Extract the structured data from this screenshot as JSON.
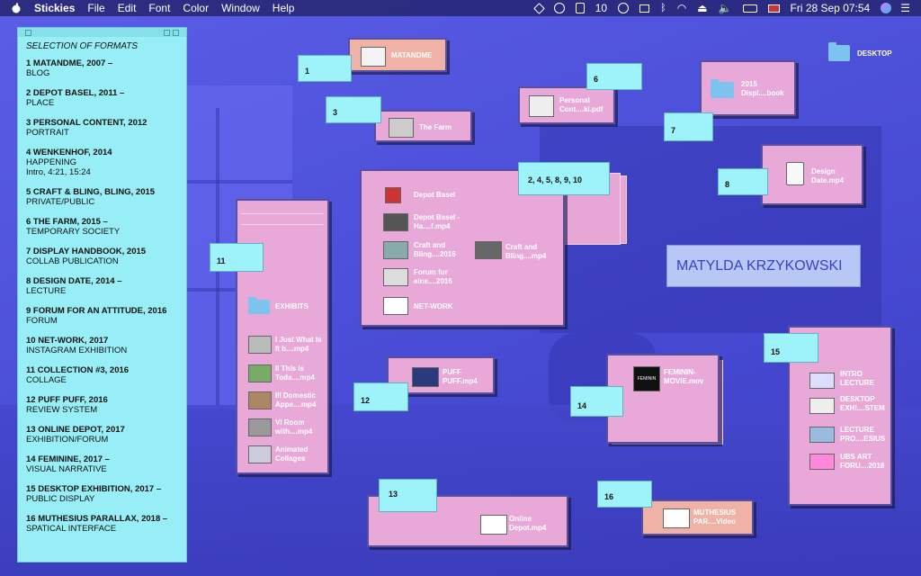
{
  "menubar": {
    "app": "Stickies",
    "menus": [
      "File",
      "Edit",
      "Font",
      "Color",
      "Window",
      "Help"
    ],
    "battery_status": "10",
    "clock": "Fri 28 Sep  07:54"
  },
  "stickies_list": {
    "header": "SELECTION OF FORMATS",
    "items": [
      {
        "title": "1 MATANDME, 2007 –",
        "sub": "BLOG"
      },
      {
        "title": "2 DEPOT BASEL, 2011 –",
        "sub": "PLACE"
      },
      {
        "title": "3 PERSONAL CONTENT, 2012",
        "sub": "PORTRAIT"
      },
      {
        "title": "4 WENKENHOF, 2014",
        "sub": "HAPPENING",
        "extra": "Intro, 4:21, 15:24"
      },
      {
        "title": "5 CRAFT & BLING, BLING, 2015",
        "sub": "PRIVATE/PUBLIC"
      },
      {
        "title": "6 THE FARM, 2015 –",
        "sub": "TEMPORARY SOCIETY"
      },
      {
        "title": "7 DISPLAY HANDBOOK, 2015",
        "sub": "COLLAB PUBLICATION"
      },
      {
        "title": "8 DESIGN DATE, 2014 –",
        "sub": "LECTURE"
      },
      {
        "title": "9 FORUM FOR AN ATTITUDE, 2016",
        "sub": "FORUM"
      },
      {
        "title": "10 NET-WORK, 2017",
        "sub": "INSTAGRAM EXHIBITION"
      },
      {
        "title": "11 COLLECTION #3, 2016",
        "sub": "COLLAGE"
      },
      {
        "title": "12 PUFF PUFF, 2016",
        "sub": "REVIEW SYSTEM"
      },
      {
        "title": "13 ONLINE DEPOT, 2017",
        "sub": "EXHIBITION/FORUM"
      },
      {
        "title": "14 FEMININE, 2017 –",
        "sub": "VISUAL NARRATIVE"
      },
      {
        "title": "15 DESKTOP EXHIBITION, 2017 –",
        "sub": "PUBLIC DISPLAY"
      },
      {
        "title": "16 MUTHESIUS PARALLAX, 2018 –",
        "sub": "SPATICAL INTERFACE"
      }
    ]
  },
  "desktop": {
    "desktop_folder": "DESKTOP",
    "name_sticky": "MATYLDA KRZYKOWSKI",
    "notes": {
      "n1": "1",
      "n2": "2, 4, 5, 8, 9, 10",
      "n3": "3",
      "n6": "6",
      "n7": "7",
      "n8": "8",
      "n11": "11",
      "n12": "12",
      "n13": "13",
      "n14": "14",
      "n15": "15",
      "n16": "16"
    },
    "labels": {
      "matandme": "MATANDME",
      "personal": "Personal Cont....ki.pdf",
      "farm": "The Farm",
      "display": "2015 Displ....book",
      "design_date": "Design Date.mp4",
      "depot_basel": "Depot Basel",
      "depot_basel_mp4": "Depot Basel - Ha....f.mp4",
      "craft1": "Craft and Bling....2016",
      "craft2": "Craft and Bling....mp4",
      "forum": "Forum fur eine....2016",
      "network": "NET-WORK",
      "exhibits": "EXHIBITS",
      "ex1": "I Just What Is It b....mp4",
      "ex2": "II This Is Toda....mp4",
      "ex3": "III Domestic Appe....mp4",
      "ex4": "VI Room with....mp4",
      "ex5": "Animated Collages",
      "puff": "PUFF PUFF.mp4",
      "feminin": "FEMININ- MOVIE.mov",
      "intro": "INTRO LECTURE",
      "desktop_exhi": "DESKTOP EXHI....STEM",
      "lecture_pro": "LECTURE PRO....ESIUS",
      "ubs": "UBS ART FORU....2018",
      "online_depot": "Online Depot.mp4",
      "muthesius": "MUTHESIUS PAR....Video",
      "feminin_thumb": "FEMININ"
    }
  }
}
